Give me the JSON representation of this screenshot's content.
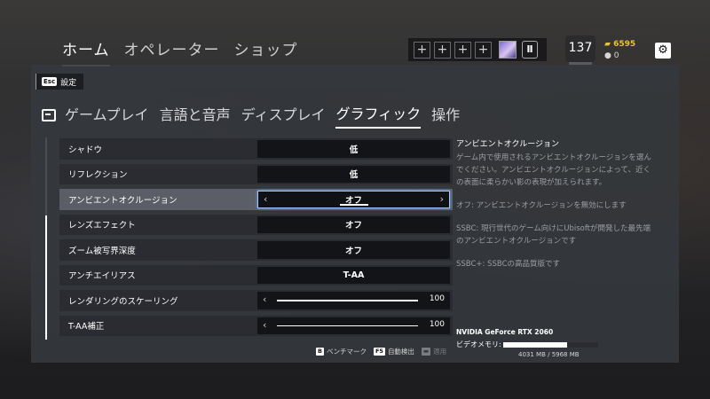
{
  "topnav": {
    "items": [
      "ホーム",
      "オペレーター",
      "ショップ"
    ]
  },
  "squad": {
    "slots": [
      "+",
      "+",
      "+",
      "+"
    ],
    "badge": "Ⅱ"
  },
  "level": "137",
  "currency": {
    "r6": "6595",
    "renown": "0"
  },
  "back": {
    "key": "Esc",
    "label": "設定"
  },
  "tabs": [
    {
      "label": "ゲームプレイ"
    },
    {
      "label": "言語と音声"
    },
    {
      "label": "ディスプレイ"
    },
    {
      "label": "グラフィック",
      "active": true
    },
    {
      "label": "操作"
    }
  ],
  "settings": [
    {
      "label": "シャドウ",
      "value": "低"
    },
    {
      "label": "リフレクション",
      "value": "低"
    },
    {
      "label": "アンビエントオクルージョン",
      "value": "オフ",
      "selected": true
    },
    {
      "label": "レンズエフェクト",
      "value": "オフ"
    },
    {
      "label": "ズーム被写界深度",
      "value": "オフ"
    },
    {
      "label": "アンチエイリアス",
      "value": "T-AA"
    },
    {
      "label": "レンダリングのスケーリング",
      "value": "100",
      "slider": 1.0
    },
    {
      "label": "T-AA補正",
      "value": "100",
      "slider": 1.0
    }
  ],
  "description": {
    "title": "アンビエントオクルージョン",
    "paragraphs": [
      "ゲーム内で使用されるアンビエントオクルージョンを選んでください。アンビエントオクルージョンによって、近くの表面に柔らかい影の表現が加えられます。",
      "オフ: アンビエントオクルージョンを無効にします",
      "SSBC: 現行世代のゲーム向けにUbisoftが開発した最先端のアンビエントオクルージョンです",
      "SSBC+: SSBCの高品質版です"
    ]
  },
  "gpu": "NVIDIA GeForce RTX 2060",
  "vram": {
    "label": "ビデオメモリ:",
    "text": "4031 MB / 5968 MB",
    "used": 4031,
    "total": 5968
  },
  "footer": {
    "benchmark": {
      "key": "B",
      "label": "ベンチマーク"
    },
    "autodetect": {
      "key": "F5",
      "label": "自動検出"
    },
    "apply": {
      "label": "適用"
    }
  }
}
